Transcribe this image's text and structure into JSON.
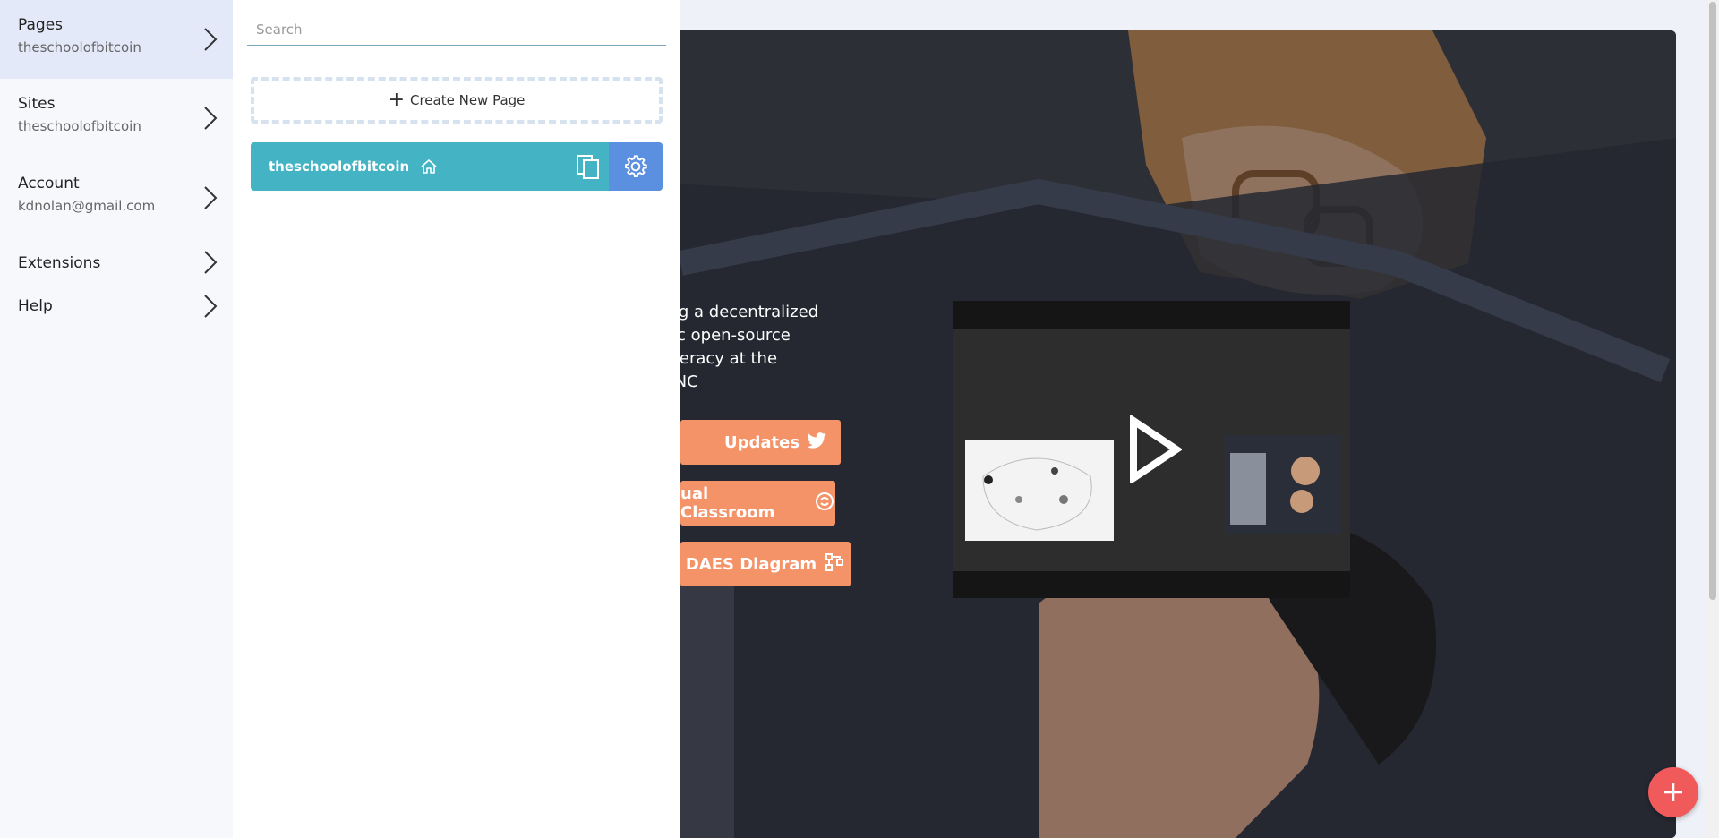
{
  "nav": {
    "items": [
      {
        "label": "Pages",
        "sub": "theschoolofbitcoin"
      },
      {
        "label": "Sites",
        "sub": "theschoolofbitcoin"
      },
      {
        "label": "Account",
        "sub": "kdnolan@gmail.com"
      },
      {
        "label": "Extensions"
      },
      {
        "label": "Help"
      }
    ]
  },
  "panel": {
    "search_placeholder": "Search",
    "create_label": "Create New Page",
    "pages": [
      {
        "name": "theschoolofbitcoin",
        "is_home": true
      }
    ]
  },
  "hero": {
    "text_lines": [
      "n is building a decentralized",
      " - a dynamic open-source",
      "financial literacy at the",
      "ystem.\" -BNC"
    ],
    "buttons": [
      {
        "label": "Updates",
        "icon": "twitter-icon"
      },
      {
        "label": "ual Classroom",
        "icon": "brain-icon"
      },
      {
        "label": "DAES Diagram",
        "icon": "flow-diagram-icon"
      }
    ]
  },
  "colors": {
    "accent": "#44b4c4",
    "gear_bg": "#5b8fe0",
    "cta": "#f49268",
    "fab": "#f05a5a"
  }
}
